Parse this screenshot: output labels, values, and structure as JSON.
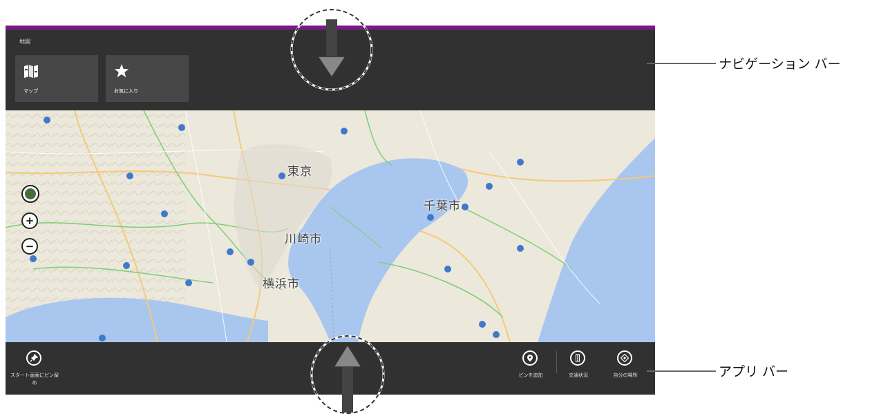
{
  "app": {
    "title": "地図",
    "accent_color": "#7a1a86"
  },
  "nav": {
    "tiles": [
      {
        "label": "マップ",
        "icon": "map-icon"
      },
      {
        "label": "お気に入り",
        "icon": "star-icon"
      }
    ]
  },
  "map": {
    "cities": [
      "東京",
      "千葉市",
      "川崎市",
      "横浜市"
    ],
    "controls": [
      "map-style-icon",
      "zoom-in-icon",
      "zoom-out-icon"
    ],
    "zoom_in_symbol": "+",
    "zoom_out_symbol": "−"
  },
  "appbar": {
    "left_buttons": [
      {
        "label": "スタート画面にピン留め",
        "icon": "pin-icon"
      }
    ],
    "right_buttons": [
      {
        "label": "ピンを追加",
        "icon": "add-pin-icon"
      },
      {
        "label": "交通状況",
        "icon": "traffic-icon"
      },
      {
        "label": "自分の場所",
        "icon": "location-icon"
      }
    ]
  },
  "annotations": {
    "nav_bar": "ナビゲーション バー",
    "app_bar": "アプリ バー"
  }
}
